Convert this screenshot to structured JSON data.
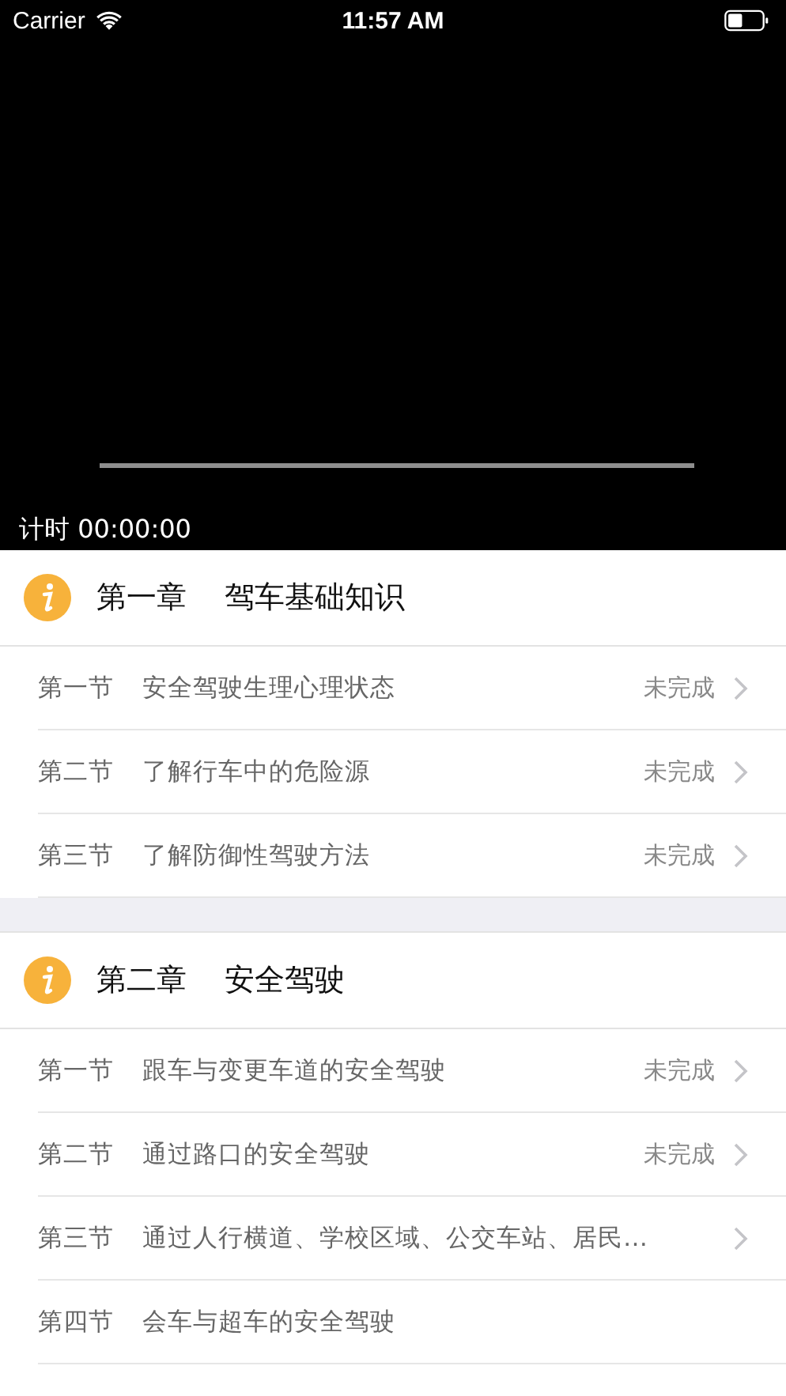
{
  "status_bar": {
    "carrier": "Carrier",
    "time": "11:57 AM"
  },
  "video": {
    "timer": "计时 00:00:00"
  },
  "chapters": [
    {
      "number": "第一章",
      "title": "驾车基础知识",
      "sections": [
        {
          "number": "第一节",
          "title": "安全驾驶生理心理状态",
          "status": "未完成",
          "chevron": true
        },
        {
          "number": "第二节",
          "title": "了解行车中的危险源",
          "status": "未完成",
          "chevron": true
        },
        {
          "number": "第三节",
          "title": "了解防御性驾驶方法",
          "status": "未完成",
          "chevron": true
        }
      ]
    },
    {
      "number": "第二章",
      "title": "安全驾驶",
      "sections": [
        {
          "number": "第一节",
          "title": "跟车与变更车道的安全驾驶",
          "status": "未完成",
          "chevron": true
        },
        {
          "number": "第二节",
          "title": "通过路口的安全驾驶",
          "status": "未完成",
          "chevron": true
        },
        {
          "number": "第三节",
          "title": "通过人行横道、学校区域、公交车站、居民…",
          "chevron": true
        },
        {
          "number": "第四节",
          "title": "会车与超车的安全驾驶",
          "chevron": false
        }
      ]
    }
  ]
}
